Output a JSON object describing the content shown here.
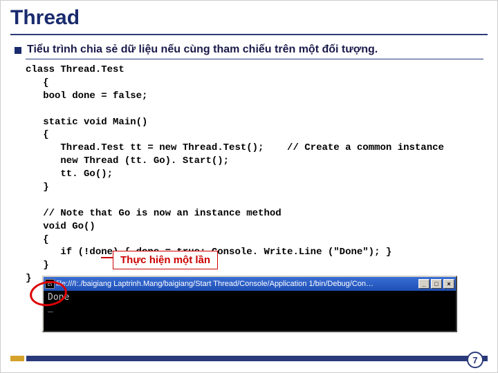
{
  "title": "Thread",
  "subtitle": "Tiểu trình chia sẻ dữ liệu nếu cùng tham chiếu trên một đối tượng.",
  "code": "class Thread.Test\n   {\n   bool done = false;\n\n   static void Main()\n   {\n      Thread.Test tt = new Thread.Test();    // Create a common instance\n      new Thread (tt. Go). Start();\n      tt. Go();\n   }\n\n   // Note that Go is now an instance method\n   void Go()\n   {\n      if (!done) { done = true; Console. Write.Line (\"Done\"); }\n   }\n}",
  "callout": "Thực hiện một lần",
  "console": {
    "title": "file:///I:./baigiang Laptrinh.Mang/baigiang/Start Thread/Console/Application 1/bin/Debug/Con…",
    "output": "Done",
    "cursor": "_"
  },
  "win_buttons": {
    "min": "_",
    "max": "□",
    "close": "×"
  },
  "page_number": "7"
}
